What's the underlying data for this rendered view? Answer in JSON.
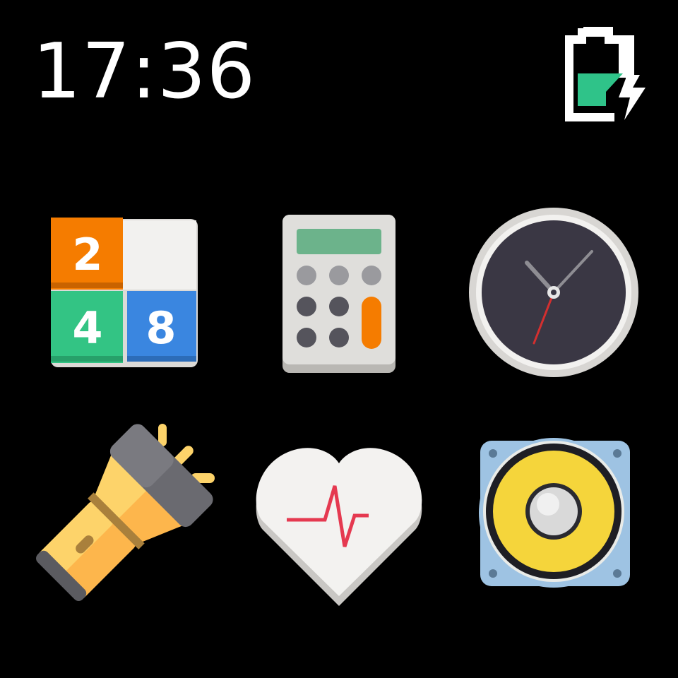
{
  "status": {
    "time": "17:36",
    "battery": {
      "level": 0.45,
      "charging": true,
      "fill_color": "#2fc389",
      "icon": "battery-charging-icon"
    }
  },
  "apps": [
    {
      "id": "game-2048",
      "icon": "2048-tiles-icon",
      "tiles": [
        "2",
        "",
        "4",
        "8"
      ],
      "tile_colors": [
        "#f57c00",
        "#f2f1ef",
        "#33c484",
        "#3a86e0"
      ]
    },
    {
      "id": "calculator",
      "icon": "calculator-icon",
      "screen_color": "#6cb38b",
      "accent_color": "#f57c00"
    },
    {
      "id": "clock",
      "icon": "analog-clock-icon",
      "face_color": "#3a3744",
      "second_hand_color": "#d32f2f"
    },
    {
      "id": "flashlight",
      "icon": "flashlight-icon",
      "body_color": "#fdb64c",
      "head_color": "#5b5b60"
    },
    {
      "id": "heart-rate",
      "icon": "heart-pulse-icon",
      "heart_color": "#f3f2f0",
      "pulse_color": "#e53950"
    },
    {
      "id": "speaker",
      "icon": "speaker-icon",
      "cone_color": "#f5d53b",
      "frame_color": "#9ec3e3"
    }
  ]
}
